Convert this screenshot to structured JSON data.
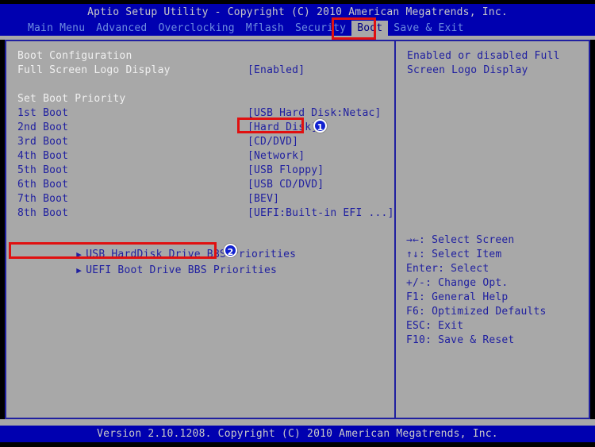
{
  "titlebar": {
    "text": "Aptio Setup Utility - Copyright (C) 2010 American Megatrends, Inc."
  },
  "menubar": {
    "items": [
      {
        "label": "Main Menu",
        "selected": false
      },
      {
        "label": "Advanced",
        "selected": false
      },
      {
        "label": "Overclocking",
        "selected": false
      },
      {
        "label": "Mflash",
        "selected": false
      },
      {
        "label": "Security",
        "selected": false
      },
      {
        "label": "Boot",
        "selected": true
      },
      {
        "label": "Save & Exit",
        "selected": false
      }
    ]
  },
  "main": {
    "boot_configuration_heading": "Boot Configuration",
    "full_screen_logo": {
      "label": "Full Screen Logo Display",
      "value": "[Enabled]"
    },
    "set_boot_priority_heading": "Set Boot Priority",
    "boot_priority": [
      {
        "label": "1st Boot",
        "value": "[USB Hard Disk:Netac]"
      },
      {
        "label": "2nd Boot",
        "value": "[Hard Disk]"
      },
      {
        "label": "3rd Boot",
        "value": "[CD/DVD]"
      },
      {
        "label": "4th Boot",
        "value": "[Network]"
      },
      {
        "label": "5th Boot",
        "value": "[USB Floppy]"
      },
      {
        "label": "6th Boot",
        "value": "[USB CD/DVD]"
      },
      {
        "label": "7th Boot",
        "value": "[BEV]"
      },
      {
        "label": "8th Boot",
        "value": "[UEFI:Built-in EFI ...]"
      }
    ],
    "submenus": [
      {
        "arrow": "▶",
        "label": "USB HardDisk Drive BBS Priorities"
      },
      {
        "arrow": "▶",
        "label": "UEFI Boot Drive BBS Priorities"
      }
    ]
  },
  "help": {
    "description_lines": [
      "Enabled or disabled Full",
      "Screen Logo Display"
    ],
    "keys": [
      "→←: Select Screen",
      "↑↓: Select Item",
      "Enter: Select",
      "+/-: Change Opt.",
      "F1: General Help",
      "F6: Optimized Defaults",
      "ESC: Exit",
      "F10: Save & Reset"
    ]
  },
  "footer": {
    "text": "Version 2.10.1208. Copyright (C) 2010 American Megatrends, Inc."
  },
  "annotations": [
    {
      "badge": "1"
    },
    {
      "badge": "2"
    }
  ],
  "colors": {
    "screen_blue": "#0000b0",
    "panel_gray": "#a8a8a8",
    "border_blue": "#2020a0",
    "text_white": "#f0f0f0",
    "menu_text": "#6d8ce0",
    "annotation_red": "#e01010",
    "badge_blue": "#1020d0"
  }
}
